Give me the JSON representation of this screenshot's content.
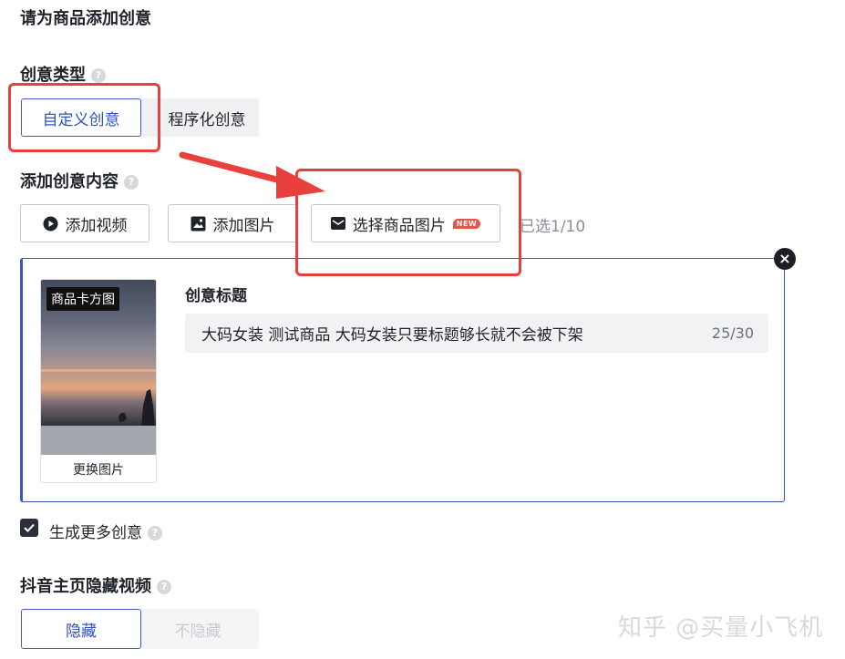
{
  "page": {
    "title": "请为商品添加创意"
  },
  "creative_type": {
    "label": "创意类型",
    "help": "?",
    "options": [
      {
        "label": "自定义创意",
        "selected": true
      },
      {
        "label": "程序化创意",
        "selected": false
      }
    ]
  },
  "add_content": {
    "label": "添加创意内容",
    "help": "?",
    "buttons": {
      "video": "添加视频",
      "image": "添加图片",
      "product_image": "选择商品图片",
      "new_badge": "NEW"
    },
    "selected_count": "已选1/10"
  },
  "creative_card": {
    "thumbnail_badge": "商品卡方图",
    "replace_image": "更换图片",
    "title_label": "创意标题",
    "title_value": "大码女装 测试商品 大码女装只要标题够长就不会被下架",
    "title_counter": "25/30",
    "close": "×"
  },
  "generate_more": {
    "label": "生成更多创意",
    "checked": true,
    "help": "?"
  },
  "douyin_hide": {
    "label": "抖音主页隐藏视频",
    "help": "?",
    "options": [
      {
        "label": "隐藏",
        "selected": true
      },
      {
        "label": "不隐藏",
        "selected": false
      }
    ]
  },
  "watermark": "知乎 @买量小飞机",
  "colors": {
    "primary": "#3150c7",
    "annotation_red": "#e8403d",
    "card_border": "#3b56b8",
    "new_badge": "#e8534a"
  }
}
